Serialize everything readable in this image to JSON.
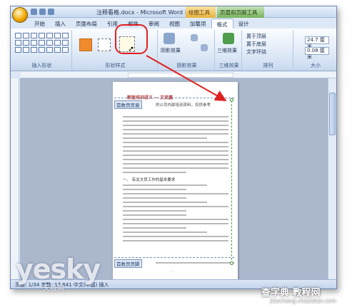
{
  "window": {
    "title": "注释看格.docx - Microsoft Word 非商业用途",
    "context_tab_drawing": "绘图工具",
    "context_tab_header_footer": "页眉和页脚工具"
  },
  "ribbon": {
    "tabs": [
      {
        "label": "开始"
      },
      {
        "label": "插入"
      },
      {
        "label": "页面布局"
      },
      {
        "label": "引用"
      },
      {
        "label": "邮件"
      },
      {
        "label": "审阅"
      },
      {
        "label": "视图"
      },
      {
        "label": "加载项"
      },
      {
        "label": "格式"
      },
      {
        "label": "设计"
      }
    ],
    "active_tab": "格式",
    "groups": {
      "insert_shapes": "插入形状",
      "shape_styles": "形状样式",
      "shadow_effects": "阴影效果",
      "three_d": "三维效果",
      "arrange": "排列",
      "size": "大小"
    },
    "buttons": {
      "shadow_effects_btn": "阴影效果",
      "three_d_btn": "三维效果",
      "bring_front": "置于顶层",
      "send_back": "置于底层",
      "text_wrap": "文字环绕",
      "height_value": "24.7 厘米",
      "width_value": "0.08 厘米"
    }
  },
  "document": {
    "heading": "新版培训讲义 — 文员篇",
    "header_tag_top": "首数页页眉",
    "header_text": "的公司内部培训资料，仅供参考",
    "header_tag_bottom": "首数页页脚",
    "section_heading": "一、 有关文员工作的基本要求"
  },
  "statusbar": {
    "page_info": "页面: 1/34   字数: 17,641   中文(中国)   插入"
  },
  "watermarks": {
    "brand": "yesky",
    "brand_sub": "天极网",
    "site": "查字典 教程网",
    "site_url": "jiaocheng.chazidian.com"
  },
  "colors": {
    "accent_red": "#e02020",
    "shape_orange": "#f08a2c",
    "selection_green": "#3b8a2c"
  }
}
